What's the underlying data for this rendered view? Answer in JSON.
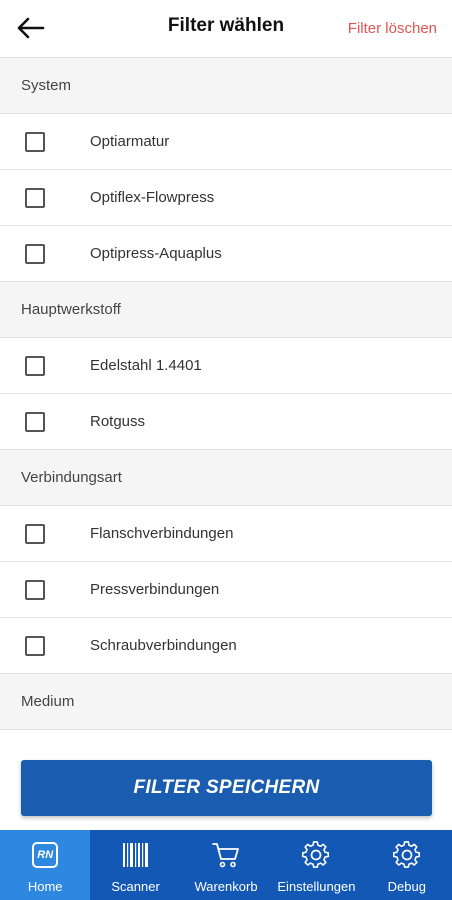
{
  "header": {
    "title": "Filter wählen",
    "clear_label": "Filter löschen"
  },
  "sections": [
    {
      "title": "System",
      "items": [
        {
          "label": "Optiarmatur",
          "checked": false
        },
        {
          "label": "Optiflex-Flowpress",
          "checked": false
        },
        {
          "label": "Optipress-Aquaplus",
          "checked": false
        }
      ]
    },
    {
      "title": "Hauptwerkstoff",
      "items": [
        {
          "label": "Edelstahl 1.4401",
          "checked": false
        },
        {
          "label": "Rotguss",
          "checked": false
        }
      ]
    },
    {
      "title": "Verbindungsart",
      "items": [
        {
          "label": "Flanschverbindungen",
          "checked": false
        },
        {
          "label": "Pressverbindungen",
          "checked": false
        },
        {
          "label": "Schraubverbindungen",
          "checked": false
        }
      ]
    },
    {
      "title": "Medium",
      "items": []
    }
  ],
  "save_button": {
    "label": "FILTER SPEICHERN"
  },
  "nav": {
    "home": {
      "label": "Home",
      "logo": "RN",
      "icon": "rn-logo-icon",
      "active": true
    },
    "scanner": {
      "label": "Scanner",
      "icon": "barcode-icon"
    },
    "cart": {
      "label": "Warenkorb",
      "icon": "cart-icon"
    },
    "settings": {
      "label": "Einstellungen",
      "icon": "gear-icon"
    },
    "debug": {
      "label": "Debug",
      "icon": "gear-icon"
    }
  },
  "colors": {
    "accent": "#1a5cb0",
    "nav_bg": "#1458b5",
    "nav_active": "#2f88e0",
    "clear_link": "#e0554f",
    "section_bg": "#f5f5f5"
  }
}
